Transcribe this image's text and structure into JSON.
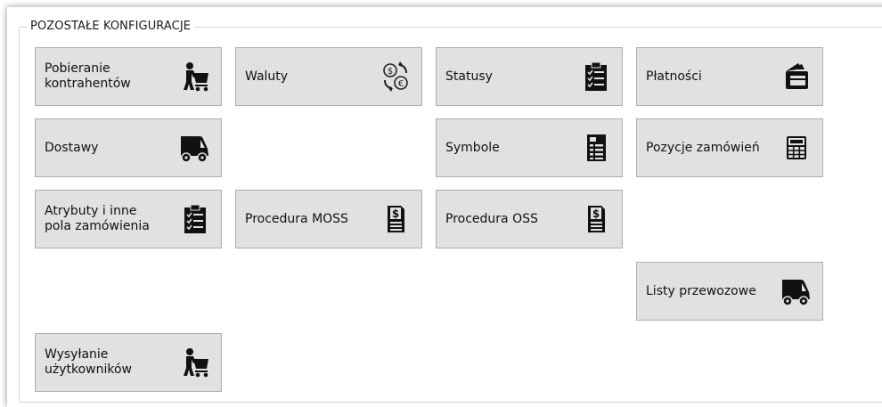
{
  "group": {
    "title": "POZOSTAŁE KONFIGURACJE"
  },
  "buttons": {
    "pobieranie": {
      "label": "Pobieranie\nkontrahentów",
      "icon": "person-cart-icon"
    },
    "waluty": {
      "label": "Waluty",
      "icon": "currency-exchange-icon"
    },
    "statusy": {
      "label": "Statusy",
      "icon": "clipboard-checklist-icon"
    },
    "platnosci": {
      "label": "Płatności",
      "icon": "wallet-icon"
    },
    "dostawy": {
      "label": "Dostawy",
      "icon": "delivery-truck-icon"
    },
    "symbole": {
      "label": "Symbole",
      "icon": "document-list-icon"
    },
    "pozycje": {
      "label": "Pozycje zamówień",
      "icon": "calculator-icon"
    },
    "atrybuty": {
      "label": "Atrybuty i inne\npola zamówienia",
      "icon": "clipboard-checklist-icon"
    },
    "moss": {
      "label": "Procedura MOSS",
      "icon": "dollar-document-icon"
    },
    "oss": {
      "label": "Procedura OSS",
      "icon": "dollar-document-icon"
    },
    "listy": {
      "label": "Listy przewozowe",
      "icon": "delivery-truck-icon"
    },
    "wysylanie": {
      "label": "Wysyłanie\nużytkowników",
      "icon": "person-cart-icon"
    }
  }
}
